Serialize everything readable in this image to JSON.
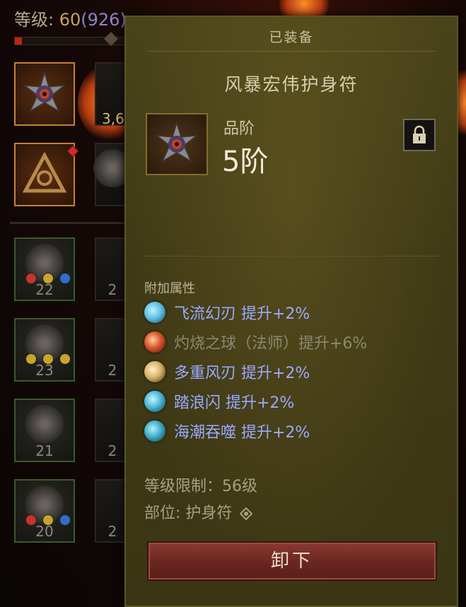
{
  "player": {
    "level_label": "等级: ",
    "level_value": "60",
    "paragon": "(926)",
    "xp_progress": 0.06
  },
  "inventory": {
    "partial_gold_text": "3,6",
    "slots": [
      {
        "count": "22",
        "gems": [
          "red",
          "yellow",
          "blue"
        ]
      },
      {
        "count": "23",
        "gems": [
          "yellow",
          "yellow",
          "yellow"
        ]
      },
      {
        "count": "21",
        "gems": []
      },
      {
        "count": "20",
        "gems": [
          "red",
          "yellow",
          "blue"
        ]
      }
    ],
    "partial_counts": [
      "2",
      "2",
      "2",
      "2"
    ]
  },
  "tooltip": {
    "header": "已装备",
    "item_name": "风暴宏伟护身符",
    "grade_label": "品阶",
    "grade_value": "5阶",
    "lock_icon": "lock-icon",
    "attributes_title": "附加属性",
    "attributes": [
      {
        "text": "飞流幻刃  提升+2%",
        "active": true,
        "color": "#5fc3e6"
      },
      {
        "text": "灼烧之球（法师）提升+6%",
        "active": false,
        "color": "#d9552a"
      },
      {
        "text": "多重风刃  提升+2%",
        "active": true,
        "color": "#d8b46a"
      },
      {
        "text": "踏浪闪  提升+2%",
        "active": true,
        "color": "#4db8d8"
      },
      {
        "text": "海潮吞噬  提升+2%",
        "active": true,
        "color": "#3fb0c8"
      }
    ],
    "level_req": "等级限制：56级",
    "slot_label": "部位: 护身符",
    "unequip_label": "卸下"
  },
  "colors": {
    "panel_bg": "#3f3a16",
    "active_attr": "#9aa9ff",
    "inactive_attr": "#8c8873",
    "button": "#6a2620"
  }
}
